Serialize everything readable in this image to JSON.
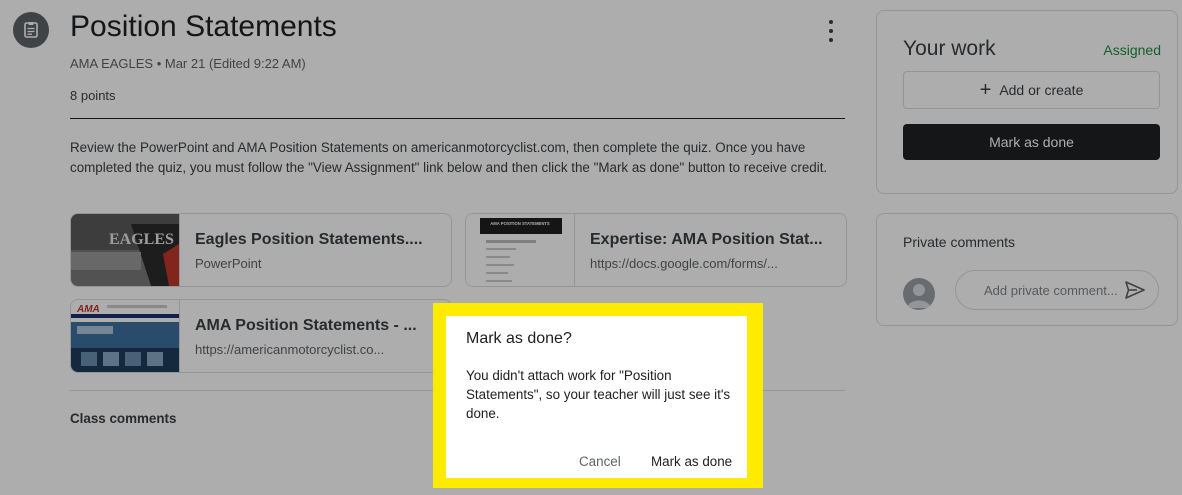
{
  "assignment": {
    "title": "Position Statements",
    "meta": "AMA EAGLES • Mar 21 (Edited 9:22 AM)",
    "points": "8 points",
    "description": "Review the PowerPoint and AMA Position Statements on americanmotorcyclist.com, then complete the quiz. Once you have completed the quiz, you must follow the \"View Assignment\" link below and then click the \"Mark as done\" button to receive credit."
  },
  "attachments": [
    {
      "title": "Eagles Position Statements....",
      "subtitle": "PowerPoint",
      "thumb_text": "EAGLES"
    },
    {
      "title": "Expertise: AMA Position Stat...",
      "subtitle": "https://docs.google.com/forms/...",
      "thumb_text": "AMA POSITION STATEMENTS"
    },
    {
      "title": "AMA Position Statements - ...",
      "subtitle": "https://americanmotorcyclist.co...",
      "thumb_text": "AMA"
    }
  ],
  "class_comments": {
    "label": "Class comments"
  },
  "your_work": {
    "title": "Your work",
    "status": "Assigned",
    "status_color": "#1e8e3e",
    "add_create_label": "Add or create",
    "mark_done_label": "Mark as done"
  },
  "private_comments": {
    "title": "Private comments",
    "placeholder": "Add private comment..."
  },
  "dialog": {
    "title": "Mark as done?",
    "body": "You didn't attach work for \"Position Statements\", so your teacher will just see it's done.",
    "cancel_label": "Cancel",
    "confirm_label": "Mark as done",
    "highlight_color": "#ffeb00"
  },
  "icons": {
    "assignment": "assignment-icon",
    "more": "more-vert-icon",
    "add": "plus-icon",
    "avatar": "avatar-icon",
    "send": "send-icon"
  }
}
